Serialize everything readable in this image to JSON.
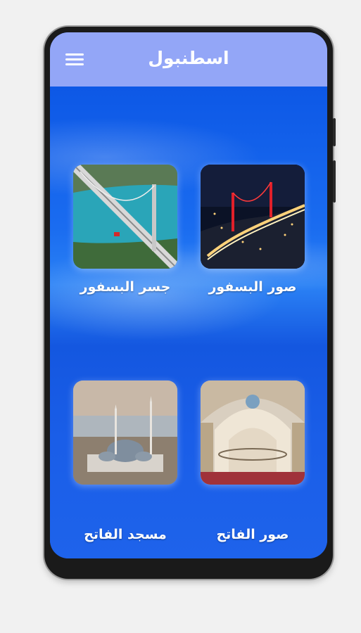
{
  "appbar": {
    "title": "اسطنبول",
    "menu_icon": "hamburger-menu-icon"
  },
  "items": [
    {
      "label": "صور البسفور"
    },
    {
      "label": "جسر البسفور"
    },
    {
      "label": "صور الفاتح"
    },
    {
      "label": "مسجد الفاتح"
    }
  ],
  "colors": {
    "appbar": "#93a6f7",
    "background": "#1c5fe6",
    "text": "#ffffff"
  }
}
